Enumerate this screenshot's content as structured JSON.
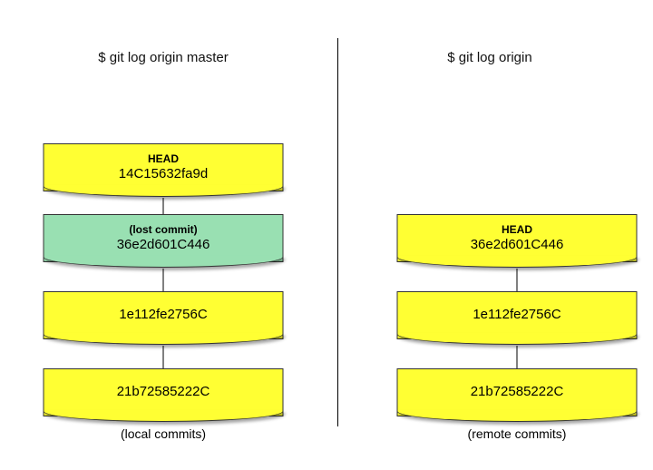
{
  "left": {
    "title": "$ git log origin master",
    "caption": "(local commits)",
    "nodes": [
      {
        "label": "HEAD",
        "hash": "14C15632fa9d",
        "color": "yellow"
      },
      {
        "label": "(lost commit)",
        "hash": "36e2d601C446",
        "color": "green"
      },
      {
        "label": "",
        "hash": "1e112fe2756C",
        "color": "yellow"
      },
      {
        "label": "",
        "hash": "21b72585222C",
        "color": "yellow"
      }
    ]
  },
  "right": {
    "title": "$ git log origin",
    "caption": "(remote commits)",
    "nodes": [
      {
        "label": "HEAD",
        "hash": "36e2d601C446",
        "color": "yellow"
      },
      {
        "label": "",
        "hash": "1e112fe2756C",
        "color": "yellow"
      },
      {
        "label": "",
        "hash": "21b72585222C",
        "color": "yellow"
      }
    ]
  }
}
